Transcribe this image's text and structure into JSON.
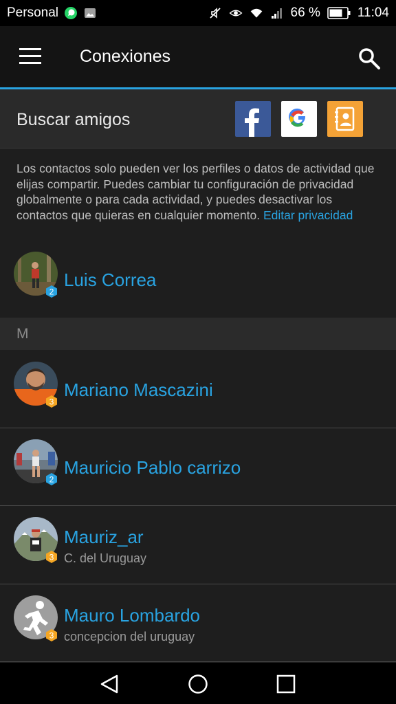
{
  "status_bar": {
    "carrier": "Personal",
    "battery": "66 %",
    "time": "11:04",
    "icons": [
      "whatsapp-icon",
      "gallery-icon",
      "mute-icon",
      "eye-icon",
      "wifi-icon",
      "signal-icon",
      "battery-icon"
    ]
  },
  "app_bar": {
    "title": "Conexiones",
    "menu_icon": "hamburger-menu-icon",
    "search_icon": "search-icon"
  },
  "find_friends": {
    "label": "Buscar amigos",
    "facebook_icon": "facebook-icon",
    "google_icon": "google-icon",
    "contacts_icon": "contacts-icon"
  },
  "privacy": {
    "text": "Los contactos solo pueden ver los perfiles o datos de actividad que elijas compartir. Puedes cambiar tu configuración de privacidad globalmente o para cada actividad, y puedes desactivar los contactos que quieras en cualquier momento.",
    "link": "Editar privacidad"
  },
  "contacts_top": [
    {
      "name": "Luis Correa",
      "level": "2"
    }
  ],
  "section_letter": "M",
  "contacts_m": [
    {
      "name": "Mariano Mascazini",
      "level": "3",
      "sub": ""
    },
    {
      "name": "Mauricio Pablo carrizo",
      "level": "2",
      "sub": ""
    },
    {
      "name": "Mauriz_ar",
      "level": "3",
      "sub": "C. del Uruguay"
    },
    {
      "name": "Mauro Lombardo",
      "level": "3",
      "sub": "concepcion del uruguay"
    }
  ],
  "colors": {
    "accent": "#29a3e1",
    "level2": "#29a3e1",
    "level3": "#f5a623",
    "facebook": "#3b5998",
    "contacts": "#f4a236"
  }
}
